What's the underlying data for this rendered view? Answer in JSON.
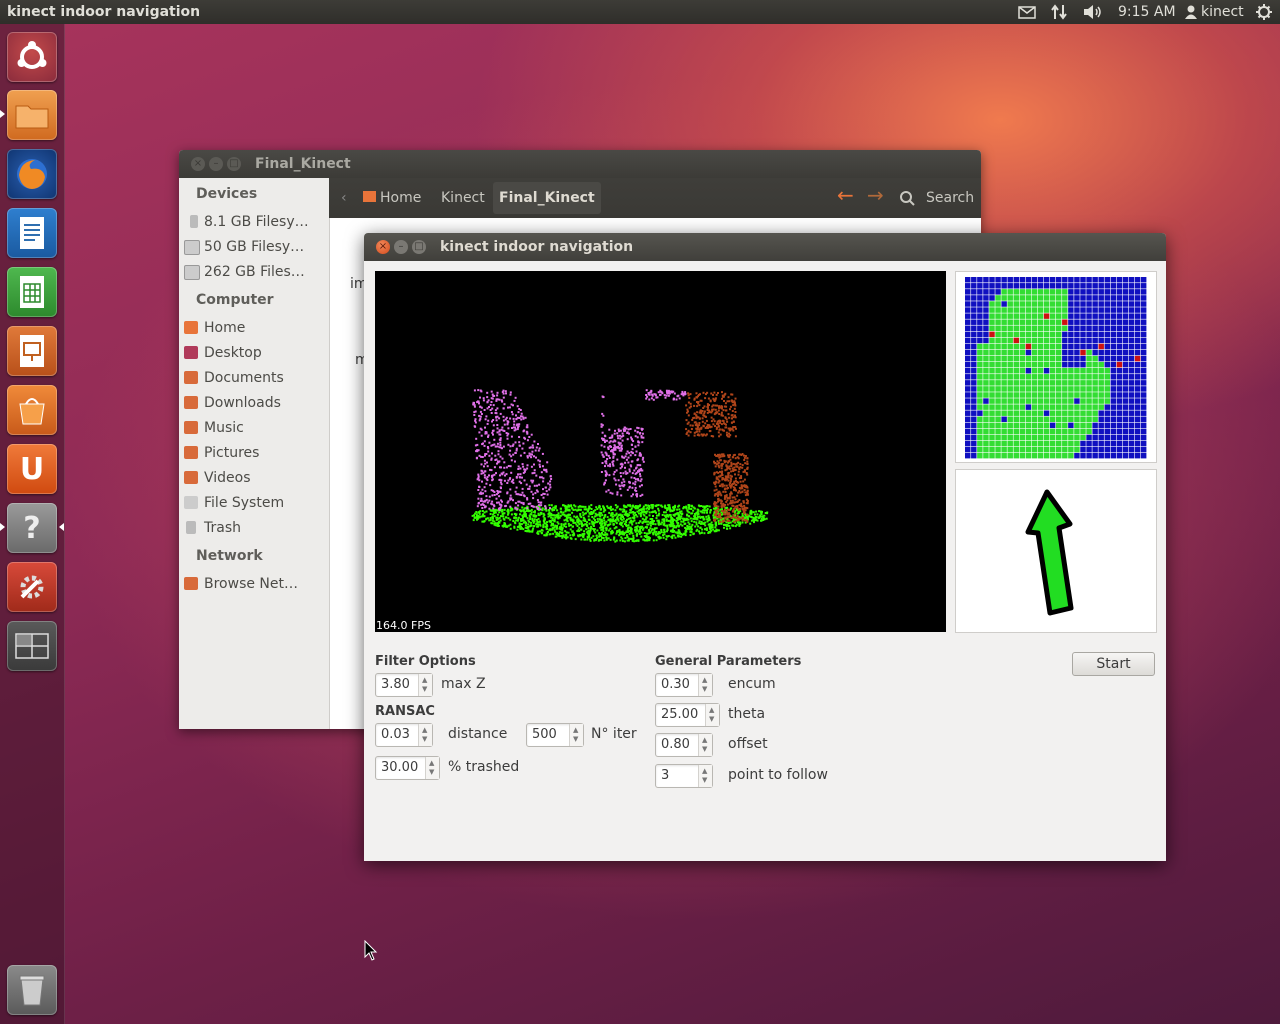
{
  "top_panel": {
    "title": "kinect indoor navigation",
    "time": "9:15 AM",
    "user": "kinect",
    "icons": [
      "mail-icon",
      "network-icon",
      "volume-icon",
      "user-icon",
      "power-gear-icon"
    ]
  },
  "launcher": {
    "items": [
      "ubuntu-dash-icon",
      "files-icon",
      "firefox-icon",
      "writer-icon",
      "calc-icon",
      "impress-icon",
      "software-center-icon",
      "ubuntu-one-icon",
      "help-icon",
      "system-settings-icon",
      "workspace-switcher-icon",
      "trash-icon"
    ]
  },
  "file_manager": {
    "title": "Final_Kinect",
    "devices_header": "Devices",
    "devices": [
      "8.1 GB Filesy…",
      "50 GB Filesy…",
      "262 GB Files…"
    ],
    "computer_header": "Computer",
    "computer": [
      "Home",
      "Desktop",
      "Documents",
      "Downloads",
      "Music",
      "Pictures",
      "Videos",
      "File System",
      "Trash"
    ],
    "network_header": "Network",
    "network": [
      "Browse Net…"
    ],
    "breadcrumbs": [
      "Home",
      "Kinect",
      "Final_Kinect"
    ],
    "search_label": "Search",
    "content_fragments": [
      "im",
      "m"
    ]
  },
  "kinect_window": {
    "title": "kinect indoor navigation",
    "fps": "164.0 FPS",
    "filter_options_label": "Filter Options",
    "max_z_value": "3.80",
    "max_z_label": "max Z",
    "ransac_label": "RANSAC",
    "distance_value": "0.03",
    "distance_label": "distance",
    "n_iter_value": "500",
    "n_iter_label": "N° iter",
    "trashed_value": "30.00",
    "trashed_label": "% trashed",
    "general_label": "General Parameters",
    "encum_value": "0.30",
    "encum_label": "encum",
    "theta_value": "25.00",
    "theta_label": "theta",
    "offset_value": "0.80",
    "offset_label": "offset",
    "point_value": "3",
    "point_label": "point to follow",
    "start_label": "Start"
  },
  "colors": {
    "floor": "#33ff00",
    "obstacle_left": "#e070e8",
    "obstacle_right": "#b0451a",
    "map_free": "#33dd33",
    "map_unknown": "#1010c0",
    "map_point": "#cc1111",
    "arrow": "#22dd22"
  }
}
